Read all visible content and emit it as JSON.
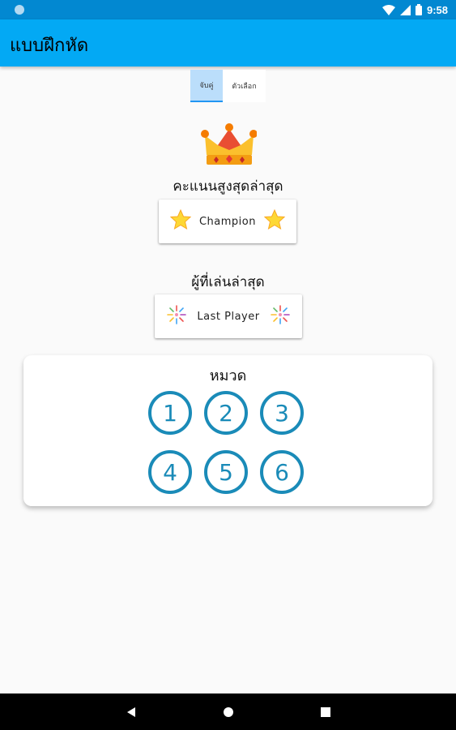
{
  "status_bar": {
    "time": "9:58",
    "icons": [
      "wifi-icon",
      "signal-icon",
      "battery-icon"
    ],
    "color": "#0288d1"
  },
  "app_bar": {
    "title": "แบบฝึกหัด",
    "color": "#03a9f4"
  },
  "tabs": [
    {
      "label": "จับคู่",
      "selected": true
    },
    {
      "label": "ตัวเลือก",
      "selected": false
    }
  ],
  "high_score": {
    "icon": "crown-icon",
    "heading": "คะแนนสูงสุดล่าสุด",
    "value": "Champion",
    "decoration_icon": "star-icon"
  },
  "last_player": {
    "heading": "ผู้ที่เล่นล่าสุด",
    "value": "Last Player",
    "decoration_icon": "sparkle-icon"
  },
  "category": {
    "title": "หมวด",
    "buttons": [
      "1",
      "2",
      "3",
      "4",
      "5",
      "6"
    ],
    "accent_color": "#1a8bb8"
  },
  "nav_bar": {
    "buttons": [
      "back-icon",
      "home-icon",
      "recents-icon"
    ]
  }
}
